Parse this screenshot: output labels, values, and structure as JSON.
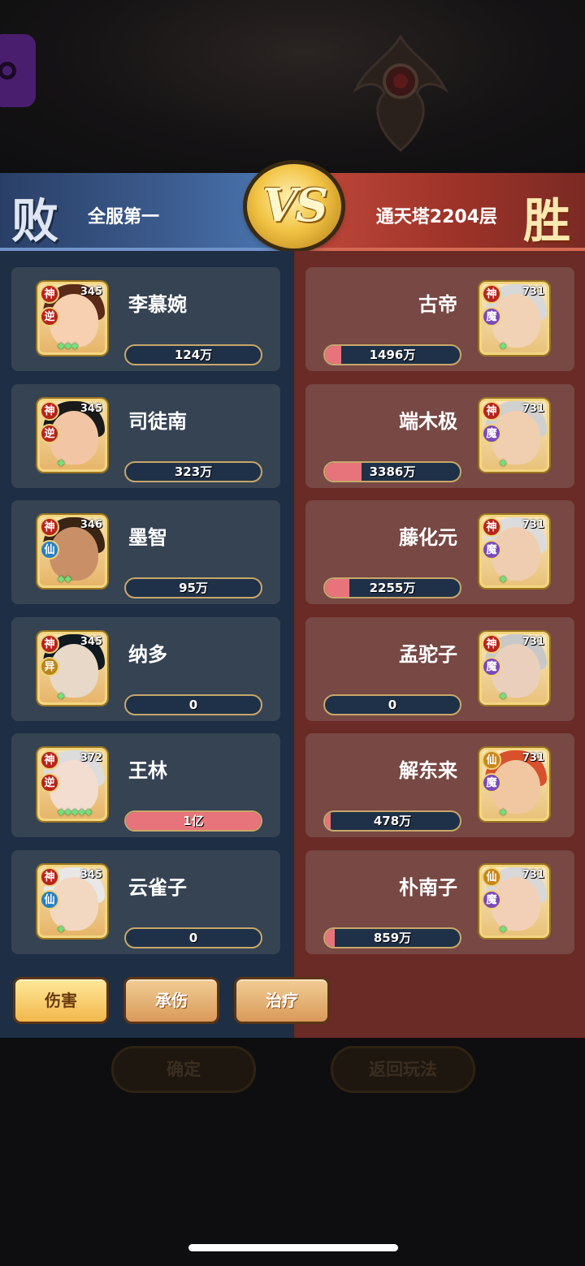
{
  "header": {
    "left_result": "败",
    "right_result": "胜",
    "left_team": "全服第一",
    "right_team": "通天塔2204层",
    "vs": "VS"
  },
  "colors": {
    "left_panel": "#1e2e45",
    "right_panel": "#6a2a26",
    "bar_fill": "#e7747a",
    "accent_gold": "#f2c445"
  },
  "left_heroes": [
    {
      "name": "李慕婉",
      "level": "345",
      "badge1": "神",
      "badge2": "逆",
      "pips": "◆◆◆",
      "value": "124万",
      "fill": 0.0
    },
    {
      "name": "司徒南",
      "level": "345",
      "badge1": "神",
      "badge2": "逆",
      "pips": "◆",
      "value": "323万",
      "fill": 0.0
    },
    {
      "name": "墨智",
      "level": "346",
      "badge1": "神",
      "badge2": "仙",
      "pips": "◆◆",
      "value": "95万",
      "fill": 0.0
    },
    {
      "name": "纳多",
      "level": "345",
      "badge1": "神",
      "badge2": "异",
      "pips": "◆",
      "value": "0",
      "fill": 0.0
    },
    {
      "name": "王林",
      "level": "372",
      "badge1": "神",
      "badge2": "逆",
      "pips": "◆◆◆◆◆",
      "value": "1亿",
      "fill": 1.0
    },
    {
      "name": "云雀子",
      "level": "345",
      "badge1": "神",
      "badge2": "仙",
      "pips": "◆",
      "value": "0",
      "fill": 0.0
    }
  ],
  "right_heroes": [
    {
      "name": "古帝",
      "level": "731",
      "badge1": "神",
      "badge2": "魔",
      "pips": "◆",
      "value": "1496万",
      "fill": 0.12
    },
    {
      "name": "端木极",
      "level": "731",
      "badge1": "神",
      "badge2": "魔",
      "pips": "◆",
      "value": "3386万",
      "fill": 0.27
    },
    {
      "name": "藤化元",
      "level": "731",
      "badge1": "神",
      "badge2": "魔",
      "pips": "◆",
      "value": "2255万",
      "fill": 0.18
    },
    {
      "name": "孟驼子",
      "level": "731",
      "badge1": "神",
      "badge2": "魔",
      "pips": "◆",
      "value": "0",
      "fill": 0.0
    },
    {
      "name": "解东来",
      "level": "731",
      "badge1": "仙",
      "badge2": "魔",
      "pips": "◆",
      "value": "478万",
      "fill": 0.04
    },
    {
      "name": "朴南子",
      "level": "731",
      "badge1": "仙",
      "badge2": "魔",
      "pips": "◆",
      "value": "859万",
      "fill": 0.07
    }
  ],
  "tabs": [
    {
      "label": "伤害",
      "active": true
    },
    {
      "label": "承伤",
      "active": false
    },
    {
      "label": "治疗",
      "active": false
    }
  ],
  "bottom": {
    "confirm": "确定",
    "back": "返回玩法"
  },
  "icons": [
    "side-menu-icon",
    "eye-emblem-icon"
  ]
}
